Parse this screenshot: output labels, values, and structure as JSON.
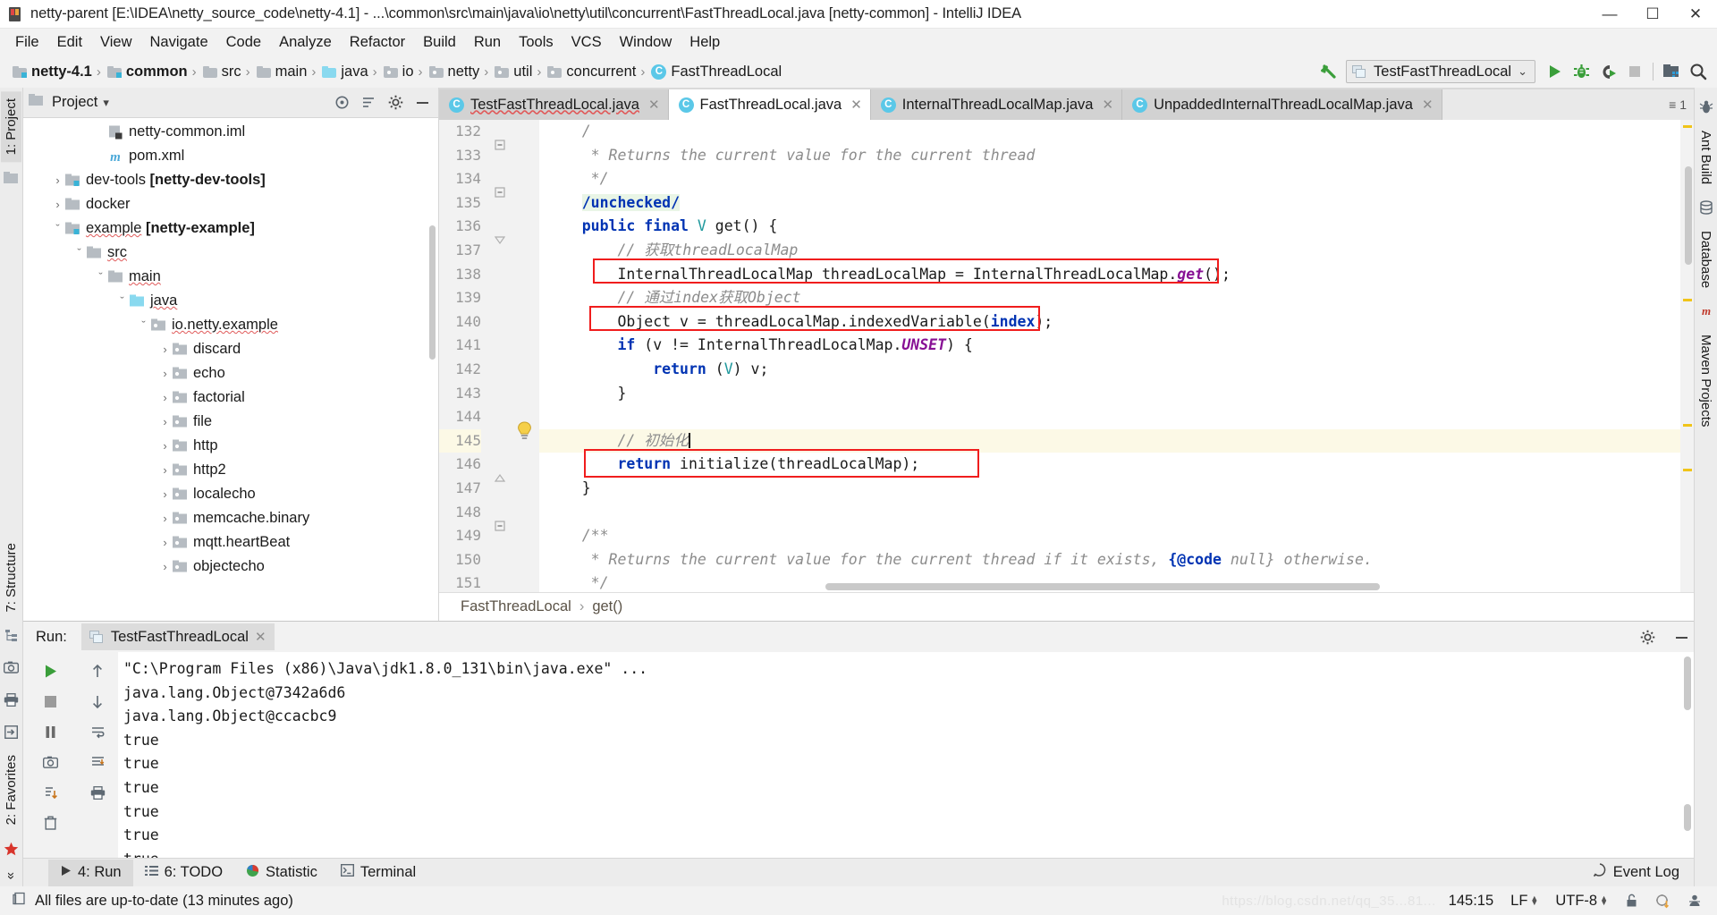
{
  "window": {
    "title": "netty-parent [E:\\IDEA\\netty_source_code\\netty-4.1] - ...\\common\\src\\main\\java\\io\\netty\\util\\concurrent\\FastThreadLocal.java [netty-common] - IntelliJ IDEA",
    "minimize": "—",
    "maximize": "☐",
    "close": "✕"
  },
  "menubar": {
    "items": [
      "File",
      "Edit",
      "View",
      "Navigate",
      "Code",
      "Analyze",
      "Refactor",
      "Build",
      "Run",
      "Tools",
      "VCS",
      "Window",
      "Help"
    ]
  },
  "navbar": {
    "crumbs": [
      {
        "label": "netty-4.1",
        "icon": "module-folder-icon",
        "bold": true
      },
      {
        "label": "common",
        "icon": "module-folder-icon",
        "bold": true
      },
      {
        "label": "src",
        "icon": "folder-icon",
        "bold": false
      },
      {
        "label": "main",
        "icon": "folder-icon",
        "bold": false
      },
      {
        "label": "java",
        "icon": "source-folder-icon",
        "bold": false
      },
      {
        "label": "io",
        "icon": "package-icon",
        "bold": false
      },
      {
        "label": "netty",
        "icon": "package-icon",
        "bold": false
      },
      {
        "label": "util",
        "icon": "package-icon",
        "bold": false
      },
      {
        "label": "concurrent",
        "icon": "package-icon",
        "bold": false
      },
      {
        "label": "FastThreadLocal",
        "icon": "class-icon",
        "bold": false
      }
    ],
    "separator": "›",
    "run_config": "TestFastThreadLocal",
    "run_config_chevron": "⌄",
    "buttons": [
      "build-hammer-icon",
      "run-button",
      "debug-button",
      "run-coverage-button",
      "stop-button",
      "project-structure-button",
      "search-everywhere-button"
    ]
  },
  "project_panel": {
    "title": "Project",
    "title_chevron": "▾",
    "header_icons": [
      "collapse-target-icon",
      "sort-icon",
      "settings-gear-icon",
      "hide-icon"
    ],
    "tree": [
      {
        "label": "netty-common.iml",
        "indent": 3,
        "arrow": "",
        "icon": "iml-file-icon",
        "bold": false,
        "squiggle": false
      },
      {
        "label": "pom.xml",
        "indent": 3,
        "arrow": "",
        "icon": "maven-file-icon",
        "bold": false,
        "squiggle": false
      },
      {
        "label": "dev-tools",
        "suffix": "[netty-dev-tools]",
        "indent": 1,
        "arrow": "›",
        "icon": "module-folder-icon",
        "bold": false,
        "squiggle": false
      },
      {
        "label": "docker",
        "indent": 1,
        "arrow": "›",
        "icon": "folder-icon",
        "bold": false,
        "squiggle": false
      },
      {
        "label": "example",
        "suffix": "[netty-example]",
        "indent": 1,
        "arrow": "⌄",
        "icon": "module-folder-icon",
        "bold": false,
        "squiggle": true
      },
      {
        "label": "src",
        "indent": 2,
        "arrow": "⌄",
        "icon": "folder-icon",
        "bold": false,
        "squiggle": true
      },
      {
        "label": "main",
        "indent": 3,
        "arrow": "⌄",
        "icon": "folder-icon",
        "bold": false,
        "squiggle": true
      },
      {
        "label": "java",
        "indent": 4,
        "arrow": "⌄",
        "icon": "source-folder-icon",
        "bold": false,
        "squiggle": true
      },
      {
        "label": "io.netty.example",
        "indent": 5,
        "arrow": "⌄",
        "icon": "package-icon",
        "bold": false,
        "squiggle": true
      },
      {
        "label": "discard",
        "indent": 6,
        "arrow": "›",
        "icon": "package-icon",
        "bold": false,
        "squiggle": false
      },
      {
        "label": "echo",
        "indent": 6,
        "arrow": "›",
        "icon": "package-icon",
        "bold": false,
        "squiggle": false
      },
      {
        "label": "factorial",
        "indent": 6,
        "arrow": "›",
        "icon": "package-icon",
        "bold": false,
        "squiggle": false
      },
      {
        "label": "file",
        "indent": 6,
        "arrow": "›",
        "icon": "package-icon",
        "bold": false,
        "squiggle": false
      },
      {
        "label": "http",
        "indent": 6,
        "arrow": "›",
        "icon": "package-icon",
        "bold": false,
        "squiggle": false
      },
      {
        "label": "http2",
        "indent": 6,
        "arrow": "›",
        "icon": "package-icon",
        "bold": false,
        "squiggle": false
      },
      {
        "label": "localecho",
        "indent": 6,
        "arrow": "›",
        "icon": "package-icon",
        "bold": false,
        "squiggle": false
      },
      {
        "label": "memcache.binary",
        "indent": 6,
        "arrow": "›",
        "icon": "package-icon",
        "bold": false,
        "squiggle": false
      },
      {
        "label": "mqtt.heartBeat",
        "indent": 6,
        "arrow": "›",
        "icon": "package-icon",
        "bold": false,
        "squiggle": false
      },
      {
        "label": "objectecho",
        "indent": 6,
        "arrow": "›",
        "icon": "package-icon",
        "bold": false,
        "squiggle": false
      }
    ]
  },
  "editor": {
    "tabs": [
      {
        "label": "TestFastThreadLocal.java",
        "active": false,
        "error": true
      },
      {
        "label": "FastThreadLocal.java",
        "active": true,
        "error": false
      },
      {
        "label": "InternalThreadLocalMap.java",
        "active": false,
        "error": false
      },
      {
        "label": "UnpaddedInternalThreadLocalMap.java",
        "active": false,
        "error": false
      }
    ],
    "tab_close": "✕",
    "tabs_menu": "≡ 1",
    "first_line_number": 132,
    "line_numbers": [
      132,
      133,
      134,
      135,
      136,
      137,
      138,
      139,
      140,
      141,
      142,
      143,
      144,
      145,
      146,
      147,
      148,
      149,
      150,
      151
    ],
    "highlight_line": 145,
    "breadcrumb": [
      "FastThreadLocal",
      "get()"
    ],
    "breadcrumb_sep": "›",
    "red_box_line_numbers": [
      138,
      140,
      146
    ],
    "code": [
      {
        "n": 132,
        "segments": [
          {
            "t": "    /",
            "c": "cmdoc"
          }
        ]
      },
      {
        "n": 133,
        "segments": [
          {
            "t": "     * Returns the current value for the current thread",
            "c": "cmdoc"
          }
        ]
      },
      {
        "n": 134,
        "segments": [
          {
            "t": "     */",
            "c": "cmdoc"
          }
        ]
      },
      {
        "n": 135,
        "segments": [
          {
            "t": "    ",
            "c": ""
          },
          {
            "t": "/unchecked/",
            "c": "an"
          }
        ]
      },
      {
        "n": 136,
        "segments": [
          {
            "t": "    ",
            "c": ""
          },
          {
            "t": "public final ",
            "c": "kw"
          },
          {
            "t": "V",
            "c": "ty"
          },
          {
            "t": " get() {",
            "c": ""
          }
        ]
      },
      {
        "n": 137,
        "segments": [
          {
            "t": "        ",
            "c": ""
          },
          {
            "t": "// 获取threadLocalMap",
            "c": "cm"
          }
        ]
      },
      {
        "n": 138,
        "segments": [
          {
            "t": "        InternalThreadLocalMap threadLocalMap = InternalThreadLocalMap.",
            "c": ""
          },
          {
            "t": "get",
            "c": "st"
          },
          {
            "t": "();",
            "c": ""
          }
        ]
      },
      {
        "n": 139,
        "segments": [
          {
            "t": "        ",
            "c": ""
          },
          {
            "t": "// 通过index获取Object",
            "c": "cm"
          }
        ]
      },
      {
        "n": 140,
        "segments": [
          {
            "t": "        Object v = threadLocalMap.indexedVariable(",
            "c": ""
          },
          {
            "t": "index",
            "c": "kw"
          },
          {
            "t": ");",
            "c": ""
          }
        ]
      },
      {
        "n": 141,
        "segments": [
          {
            "t": "        ",
            "c": ""
          },
          {
            "t": "if",
            "c": "kw"
          },
          {
            "t": " (v != InternalThreadLocalMap.",
            "c": ""
          },
          {
            "t": "UNSET",
            "c": "st"
          },
          {
            "t": ") {",
            "c": ""
          }
        ]
      },
      {
        "n": 142,
        "segments": [
          {
            "t": "            ",
            "c": ""
          },
          {
            "t": "return",
            "c": "kw"
          },
          {
            "t": " (",
            "c": ""
          },
          {
            "t": "V",
            "c": "ty"
          },
          {
            "t": ") v;",
            "c": ""
          }
        ]
      },
      {
        "n": 143,
        "segments": [
          {
            "t": "        }",
            "c": ""
          }
        ]
      },
      {
        "n": 144,
        "segments": [
          {
            "t": "",
            "c": ""
          }
        ]
      },
      {
        "n": 145,
        "segments": [
          {
            "t": "        ",
            "c": ""
          },
          {
            "t": "// 初始化",
            "c": "cm"
          }
        ]
      },
      {
        "n": 146,
        "segments": [
          {
            "t": "        ",
            "c": ""
          },
          {
            "t": "return",
            "c": "kw"
          },
          {
            "t": " initialize(threadLocalMap);",
            "c": ""
          }
        ]
      },
      {
        "n": 147,
        "segments": [
          {
            "t": "    }",
            "c": ""
          }
        ]
      },
      {
        "n": 148,
        "segments": [
          {
            "t": "",
            "c": ""
          }
        ]
      },
      {
        "n": 149,
        "segments": [
          {
            "t": "    /**",
            "c": "cmdoc"
          }
        ]
      },
      {
        "n": 150,
        "segments": [
          {
            "t": "     * Returns the current value for the current thread if it exists, ",
            "c": "cmdoc"
          },
          {
            "t": "{@code",
            "c": "tag"
          },
          {
            "t": " null} otherwise.",
            "c": "cmdoc"
          }
        ]
      },
      {
        "n": 151,
        "segments": [
          {
            "t": "     */",
            "c": "cmdoc"
          }
        ]
      }
    ]
  },
  "run_panel": {
    "label": "Run:",
    "tab_label": "TestFastThreadLocal",
    "tab_close": "✕",
    "header_icons": [
      "settings-gear-icon",
      "hide-panel-icon"
    ],
    "gutter_buttons": [
      "rerun-button",
      "stop-button",
      "pause-button",
      "screenshot-button",
      "export-button",
      "trash-button"
    ],
    "gutter2_buttons": [
      "scroll-up-button",
      "scroll-down-button",
      "soft-wrap-button",
      "scroll-to-end-button",
      "print-button"
    ],
    "console": [
      {
        "text": "\"C:\\Program Files (x86)\\Java\\jdk1.8.0_131\\bin\\java.exe\" ...",
        "cmd": true
      },
      {
        "text": "java.lang.Object@7342a6d6",
        "cmd": false
      },
      {
        "text": "java.lang.Object@ccacbc9",
        "cmd": false
      },
      {
        "text": "true",
        "cmd": false
      },
      {
        "text": "true",
        "cmd": false
      },
      {
        "text": "true",
        "cmd": false
      },
      {
        "text": "true",
        "cmd": false
      },
      {
        "text": "true",
        "cmd": false
      },
      {
        "text": "true",
        "cmd": false
      }
    ]
  },
  "left_strip": {
    "tabs": [
      "1: Project"
    ],
    "structure_tab": "7: Structure",
    "favorites_tab": "2: Favorites",
    "more": "»"
  },
  "right_strip": {
    "tabs": [
      "Ant Build",
      "Database",
      "Maven Projects"
    ]
  },
  "bottom_strip": {
    "tabs": [
      {
        "label": "4: Run",
        "icon": "run-icon",
        "selected": true,
        "mnemonic": "4"
      },
      {
        "label": "6: TODO",
        "icon": "todo-icon",
        "selected": false,
        "mnemonic": "6"
      },
      {
        "label": "Statistic",
        "icon": "statistic-icon",
        "selected": false,
        "mnemonic": ""
      },
      {
        "label": "Terminal",
        "icon": "terminal-icon",
        "selected": false,
        "mnemonic": ""
      }
    ],
    "event_log": "Event Log"
  },
  "status_bar": {
    "message": "All files are up-to-date (13 minutes ago)",
    "caret_position": "145:15",
    "line_separator": "LF",
    "encoding": "UTF-8",
    "watermark": "https://blog.csdn.net/qq_35...81...",
    "icons": [
      "lock-icon",
      "inspection-icon",
      "ide-heap-icon"
    ]
  },
  "colors": {
    "accent_green": "#3a9e3a",
    "redbox": "#f01d1d",
    "selection_blue": "#4a9fd8",
    "highlight_yellow": "#fcf9e6"
  }
}
